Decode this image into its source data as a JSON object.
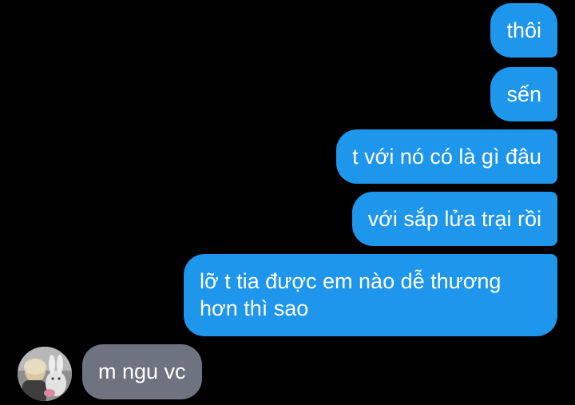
{
  "conversation": {
    "outgoing": [
      {
        "text": "thôi"
      },
      {
        "text": "sến"
      },
      {
        "text": "t với nó có là gì đâu"
      },
      {
        "text": "với sắp lửa trại rồi"
      },
      {
        "text": "lỡ t tia được em nào dễ thương hơn thì sao"
      }
    ],
    "incoming": [
      {
        "text": "m ngu vc"
      }
    ]
  },
  "colors": {
    "background": "#000000",
    "outgoing_bubble": "#1e96eb",
    "incoming_bubble": "#6d7480",
    "text": "#ffffff"
  },
  "icons": {
    "avatar": "contact-avatar-photo"
  }
}
